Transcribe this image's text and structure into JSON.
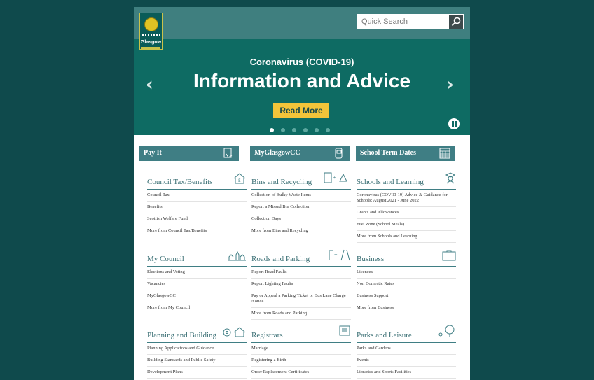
{
  "header": {
    "logo_text": "Glasgow",
    "search": {
      "placeholder": "Quick Search"
    }
  },
  "hero": {
    "kicker": "Coronavirus (COVID-19)",
    "title": "Information and Advice",
    "button": "Read More",
    "slide_count": 6,
    "active_slide": 1
  },
  "quick_links": [
    {
      "label": "Pay It",
      "icon": "hand-card-icon"
    },
    {
      "label": "MyGlasgowCC",
      "icon": "phone-chat-icon"
    },
    {
      "label": "School Term Dates",
      "icon": "calendar-icon"
    }
  ],
  "sections": [
    {
      "title": "Council Tax/Benefits",
      "icon": "house-pound-icon",
      "links": [
        "Council Tax",
        "Benefits",
        "Scottish Welfare Fund",
        "More from Council Tax/Benefits"
      ]
    },
    {
      "title": "Bins and Recycling",
      "icon": "bin-recycle-icon",
      "links": [
        "Collection of Bulky Waste Items",
        "Report a Missed Bin Collection",
        "Collection Days",
        "More from Bins and Recycling"
      ]
    },
    {
      "title": "Schools and Learning",
      "icon": "graduate-icon",
      "links": [
        "Coronavirus (COVID-19) Advice & Guidance for Schools: August 2021 - June 2022",
        "Grants and Allowances",
        "Fuel Zone (School Meals)",
        "More from Schools and Learning"
      ]
    },
    {
      "title": "My Council",
      "icon": "city-chambers-icon",
      "links": [
        "Elections and Voting",
        "Vacancies",
        "MyGlasgowCC",
        "More from My Council"
      ]
    },
    {
      "title": "Roads and Parking",
      "icon": "streetlight-road-icon",
      "links": [
        "Report Road Faults",
        "Report Lighting Faults",
        "Pay or Appeal a Parking Ticket or Bus Lane Charge Notice",
        "More from Roads and Parking"
      ]
    },
    {
      "title": "Business",
      "icon": "briefcase-icon",
      "links": [
        "Licences",
        "Non Domestic Rates",
        "Business Support",
        "More from Business"
      ]
    },
    {
      "title": "Planning and Building",
      "icon": "pin-house-icon",
      "links": [
        "Planning Applications and Guidance",
        "Building Standards and Public Safety",
        "Development Plans"
      ]
    },
    {
      "title": "Registrars",
      "icon": "certificate-icon",
      "links": [
        "Marriage",
        "Registering a Birth",
        "Order Replacement Certificates"
      ]
    },
    {
      "title": "Parks and Leisure",
      "icon": "tree-icon",
      "links": [
        "Parks and Gardens",
        "Events",
        "Libraries and Sports Facilities"
      ]
    }
  ],
  "colors": {
    "background": "#0f4a4c",
    "hero": "#0e6b63",
    "accent": "#f3c43a",
    "teal_bar": "#3f7e84"
  }
}
